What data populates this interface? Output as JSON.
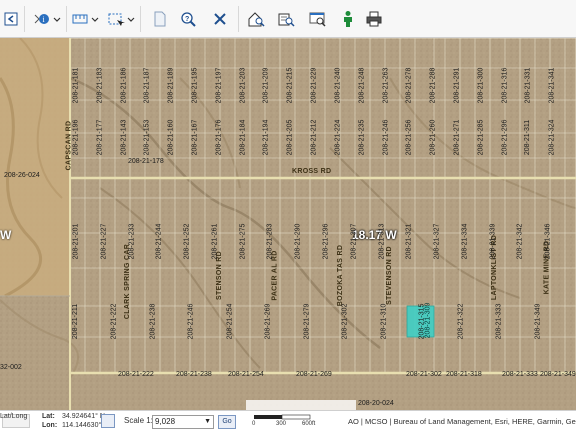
{
  "toolbar": {
    "buttons": [
      {
        "icon": "share-icon"
      },
      {
        "icon": "info-icon"
      },
      {
        "icon": "measure-icon"
      },
      {
        "icon": "select-icon"
      },
      {
        "icon": "document-icon"
      },
      {
        "icon": "query-icon"
      },
      {
        "icon": "clear-icon"
      },
      {
        "icon": "home-search-icon"
      },
      {
        "icon": "address-search-icon"
      },
      {
        "icon": "search-window-icon"
      },
      {
        "icon": "street-view-icon"
      },
      {
        "icon": "print-icon"
      }
    ]
  },
  "map": {
    "township_label": "18.17 W",
    "side_label": "W",
    "highlight_color": "#3fcfc5",
    "road_color": "#e8dfb0",
    "parcel_line_color": "#efe9d6",
    "roads_horizontal": [
      "KROSS RD",
      "AL OR AL RD"
    ],
    "roads_vertical": [
      "CAPSCAN RD",
      "CLARK SPRING CAR",
      "STENSON RD",
      "PACER AL RD",
      "BOZOKA TAS RD",
      "STEVENSON RD",
      "LAPTONKLIST RD",
      "KATE MINE RD"
    ],
    "block_labels_top": [
      "208-26-024",
      "208-21-178"
    ],
    "block_labels_bottom": [
      "208-21-222",
      "208-21-238",
      "208-21-254",
      "208-21-269",
      "208-21-302",
      "208-21-318",
      "208-21-333",
      "208-21-349"
    ],
    "block_label_lower_left": "32-002",
    "block_label_bottom_center": "208-20-024",
    "highlighted_parcel_label": "208-21-309",
    "parcels_row1": [
      "208-21-181",
      "208-21-183",
      "208-21-186",
      "208-21-187",
      "208-21-189",
      "208-21-195",
      "208-21-197",
      "208-21-203",
      "208-21-209",
      "208-21-215",
      "208-21-229",
      "208-21-240",
      "208-21-248",
      "208-21-263",
      "208-21-278",
      "208-21-288",
      "208-21-291",
      "208-21-300",
      "208-21-316",
      "208-21-331",
      "208-21-341"
    ],
    "parcels_row2": [
      "208-21-196",
      "208-21-177",
      "208-21-143",
      "208-21-153",
      "208-21-160",
      "208-21-167",
      "208-21-176",
      "208-21-184",
      "208-21-194",
      "208-21-205",
      "208-21-212",
      "208-21-224",
      "208-21-235",
      "208-21-246",
      "208-21-256",
      "208-21-260",
      "208-21-271",
      "208-21-285",
      "208-21-296",
      "208-21-311",
      "208-21-324"
    ],
    "parcels_row3": [
      "208-21-201",
      "208-21-227",
      "208-21-233",
      "208-21-244",
      "208-21-252",
      "208-21-261",
      "208-21-275",
      "208-21-283",
      "208-21-290",
      "208-21-296",
      "208-21-307",
      "208-21-313",
      "208-21-321",
      "208-21-327",
      "208-21-334",
      "208-21-339",
      "208-21-342",
      "208-21-346"
    ],
    "parcels_row4": [
      "208-21-211",
      "208-21-222",
      "208-21-238",
      "208-21-246",
      "208-21-254",
      "208-21-269",
      "208-21-279",
      "208-21-302",
      "208-21-310",
      "208-21-315",
      "208-21-322",
      "208-21-333",
      "208-21-349"
    ]
  },
  "status": {
    "lat_label": "Lat:",
    "lat_value": "34.924641° N",
    "lon_label": "Lon:",
    "lon_value": "114.144630° W",
    "latlong_label": "Lat/Long",
    "scale_label": "Scale 1:",
    "scale_value": "9,028",
    "go_label": "Go",
    "scalebar_ticks": [
      "0",
      "300",
      "600ft"
    ],
    "attribution": "AO | MCSO | Bureau of Land Management, Esri, HERE, Garmin, GeoTechnologies, I"
  }
}
